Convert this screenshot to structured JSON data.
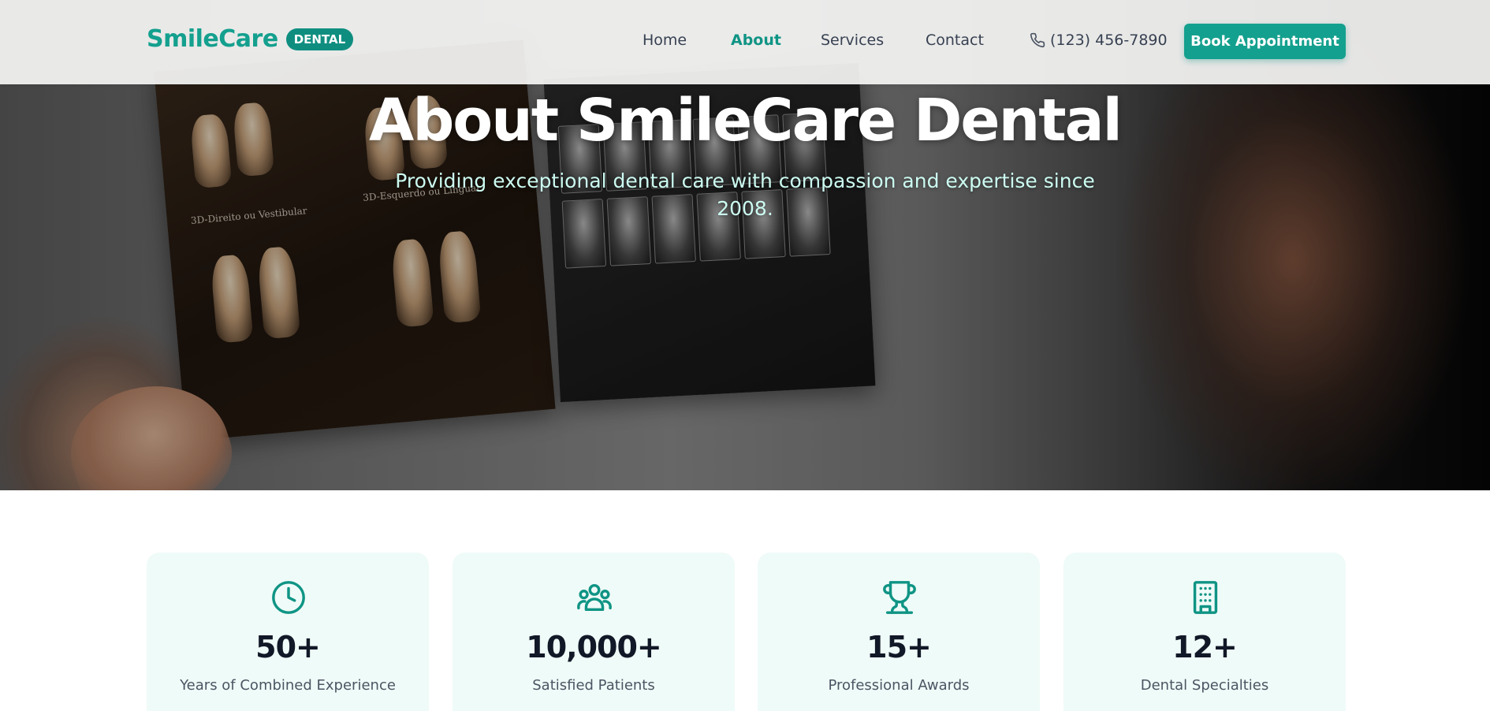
{
  "brand": {
    "name": "SmileCare",
    "badge": "DENTAL"
  },
  "nav": {
    "items": [
      {
        "label": "Home",
        "active": false
      },
      {
        "label": "About",
        "active": true
      },
      {
        "label": "Services",
        "active": false
      },
      {
        "label": "Contact",
        "active": false
      }
    ],
    "phone": "(123) 456-7890",
    "phone_icon": "phone-icon",
    "cta_label": "Book Appointment"
  },
  "hero": {
    "title": "About SmileCare Dental",
    "subtitle": "Providing exceptional dental care with compassion and expertise since 2008.",
    "image_captions": [
      "3D-Direito ou Vestibular",
      "3D-Esquerdo ou Lingual"
    ]
  },
  "stats": [
    {
      "icon": "clock-icon",
      "value": "50+",
      "label": "Years of Combined Experience"
    },
    {
      "icon": "users-icon",
      "value": "10,000+",
      "label": "Satisfied Patients"
    },
    {
      "icon": "trophy-icon",
      "value": "15+",
      "label": "Professional Awards"
    },
    {
      "icon": "building-icon",
      "value": "12+",
      "label": "Dental Specialties"
    }
  ],
  "colors": {
    "brand": "#14a08e",
    "brand_dark": "#0f8e80",
    "subtitle": "#ccfbf1",
    "card_bg": "#effbf8",
    "heading": "#111827"
  }
}
